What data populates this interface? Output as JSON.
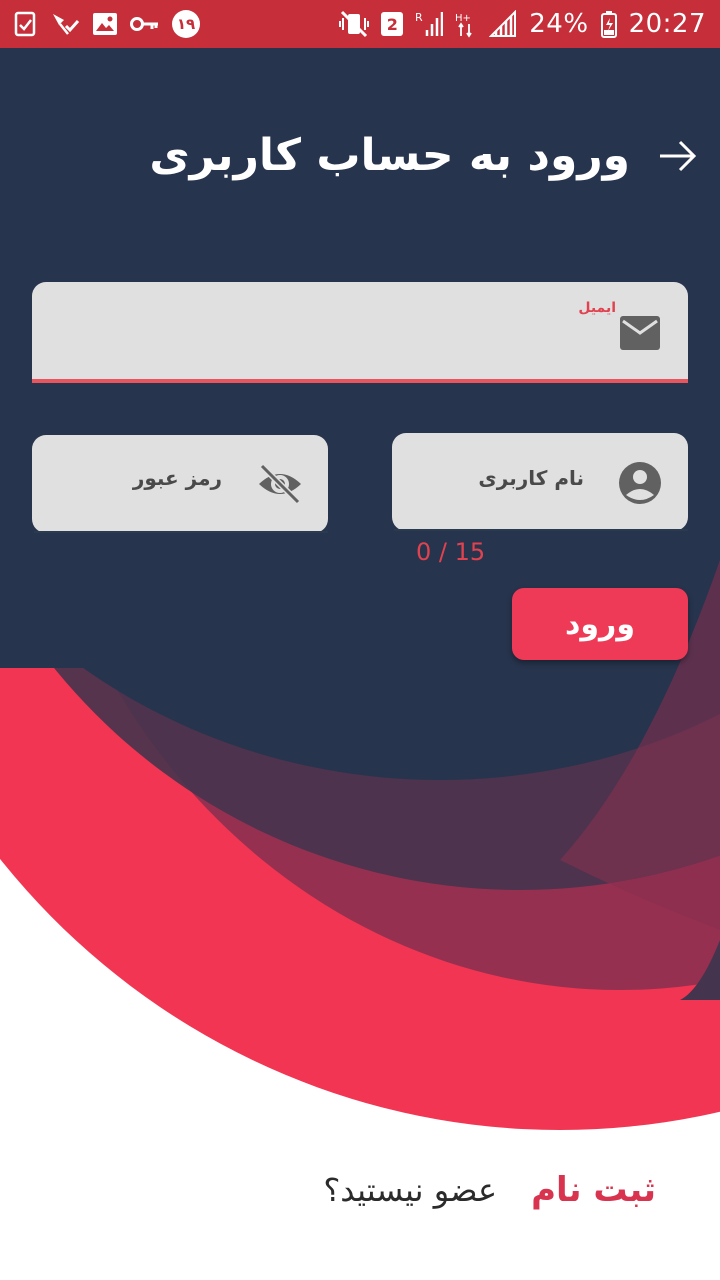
{
  "status_bar": {
    "notification_count": "۱۹",
    "sim_slot": "2",
    "network_type": "H+",
    "roaming": "R",
    "battery": "24%",
    "time": "20:27"
  },
  "header": {
    "title": "ورود به حساب کاربری",
    "back_icon": "arrow-right-icon"
  },
  "form": {
    "email": {
      "label": "ایمیل",
      "value": "",
      "icon": "mail-icon"
    },
    "username": {
      "label": "نام کاربری",
      "counter": "0 / 15",
      "icon": "account-circle-icon"
    },
    "password": {
      "label": "رمز عبور",
      "icon": "eye-off-icon"
    },
    "login_label": "ورود"
  },
  "footer": {
    "not_member": "عضو نیستید؟",
    "register": "ثبت نام"
  },
  "colors": {
    "navy": "#27344d",
    "accent": "#ef3a57",
    "status_bar": "#c62f3a",
    "field": "#e0e0e0"
  }
}
